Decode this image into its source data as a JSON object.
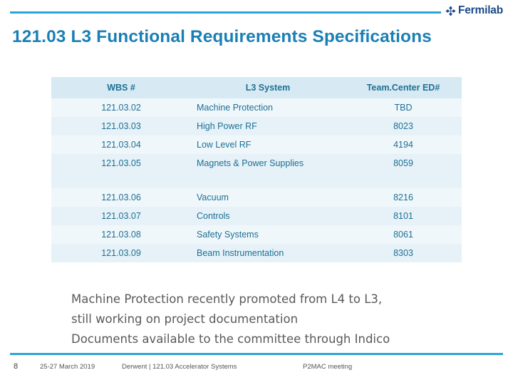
{
  "brand": {
    "logo_text": "Fermilab",
    "logo_icon": "fermilab-logo-icon",
    "accent_color": "#2ba6d9",
    "title_color": "#1a7fb5"
  },
  "title": "121.03 L3 Functional Requirements Specifications",
  "table": {
    "headers": [
      "WBS #",
      "L3 System",
      "Team.Center ED#"
    ],
    "rows": [
      {
        "wbs": "121.03.02",
        "system": "Machine Protection",
        "ed": "TBD"
      },
      {
        "wbs": "121.03.03",
        "system": "High Power RF",
        "ed": "8023"
      },
      {
        "wbs": "121.03.04",
        "system": "Low Level RF",
        "ed": "4194"
      },
      {
        "wbs": "121.03.05",
        "system": "Magnets & Power Supplies",
        "ed": "8059"
      },
      {
        "wbs": "121.03.06",
        "system": "Vacuum",
        "ed": "8216"
      },
      {
        "wbs": "121.03.07",
        "system": "Controls",
        "ed": "8101"
      },
      {
        "wbs": "121.03.08",
        "system": "Safety Systems",
        "ed": "8061"
      },
      {
        "wbs": "121.03.09",
        "system": "Beam Instrumentation",
        "ed": "8303"
      }
    ]
  },
  "notes": [
    "Machine Protection recently promoted from L4 to L3,",
    "still working on project documentation",
    "Documents available to the committee through Indico"
  ],
  "footer": {
    "page_number": "8",
    "date": "25-27 March 2019",
    "middle": "Derwent | 121.03 Accelerator Systems",
    "right": "P2MAC meeting"
  }
}
